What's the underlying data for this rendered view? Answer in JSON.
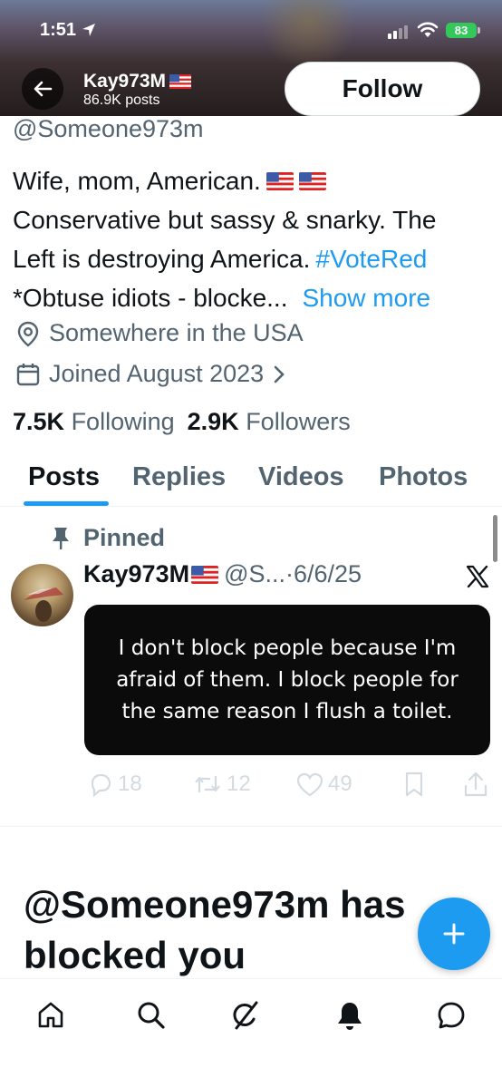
{
  "status_bar": {
    "time": "1:51",
    "battery": "83"
  },
  "header": {
    "name": "Kay973M",
    "posts": "86.9K posts",
    "follow_label": "Follow"
  },
  "profile": {
    "handle": "@Someone973m",
    "bio_line1": "Wife, mom, American.",
    "bio_line2": "Conservative but sassy & snarky. The",
    "bio_line3": "Left is destroying America.",
    "bio_hashtag": "#VoteRed",
    "bio_line4": "*Obtuse idiots - blocke...",
    "show_more": "Show more",
    "location": "Somewhere in the USA",
    "joined": "Joined August 2023",
    "following_count": "7.5K",
    "following_label": "Following",
    "followers_count": "2.9K",
    "followers_label": "Followers"
  },
  "tabs": [
    {
      "label": "Posts",
      "active": true
    },
    {
      "label": "Replies",
      "active": false
    },
    {
      "label": "Videos",
      "active": false
    },
    {
      "label": "Photos",
      "active": false
    }
  ],
  "pinned_post": {
    "pinned_label": "Pinned",
    "author": "Kay973M",
    "handle": "@S...",
    "date": "·6/6/25",
    "image_text_line1": "I don't block people because I'm",
    "image_text_line2": "afraid of them. I block people for",
    "image_text_line3": "the same reason I flush a toilet.",
    "replies": "18",
    "reposts": "12",
    "likes": "49"
  },
  "blocked_message": "@Someone973m has blocked you",
  "icons": {
    "back": "back-arrow-icon",
    "location": "location-pin-icon",
    "calendar": "calendar-icon",
    "pin": "pin-icon",
    "x_logo": "x-logo-icon",
    "compose": "plus-icon",
    "nav": [
      "home-icon",
      "search-icon",
      "grok-icon",
      "notifications-icon",
      "messages-icon"
    ]
  },
  "colors": {
    "accent": "#1d9bf0",
    "muted": "#536471",
    "text": "#0f1419",
    "battery": "#34c759"
  }
}
